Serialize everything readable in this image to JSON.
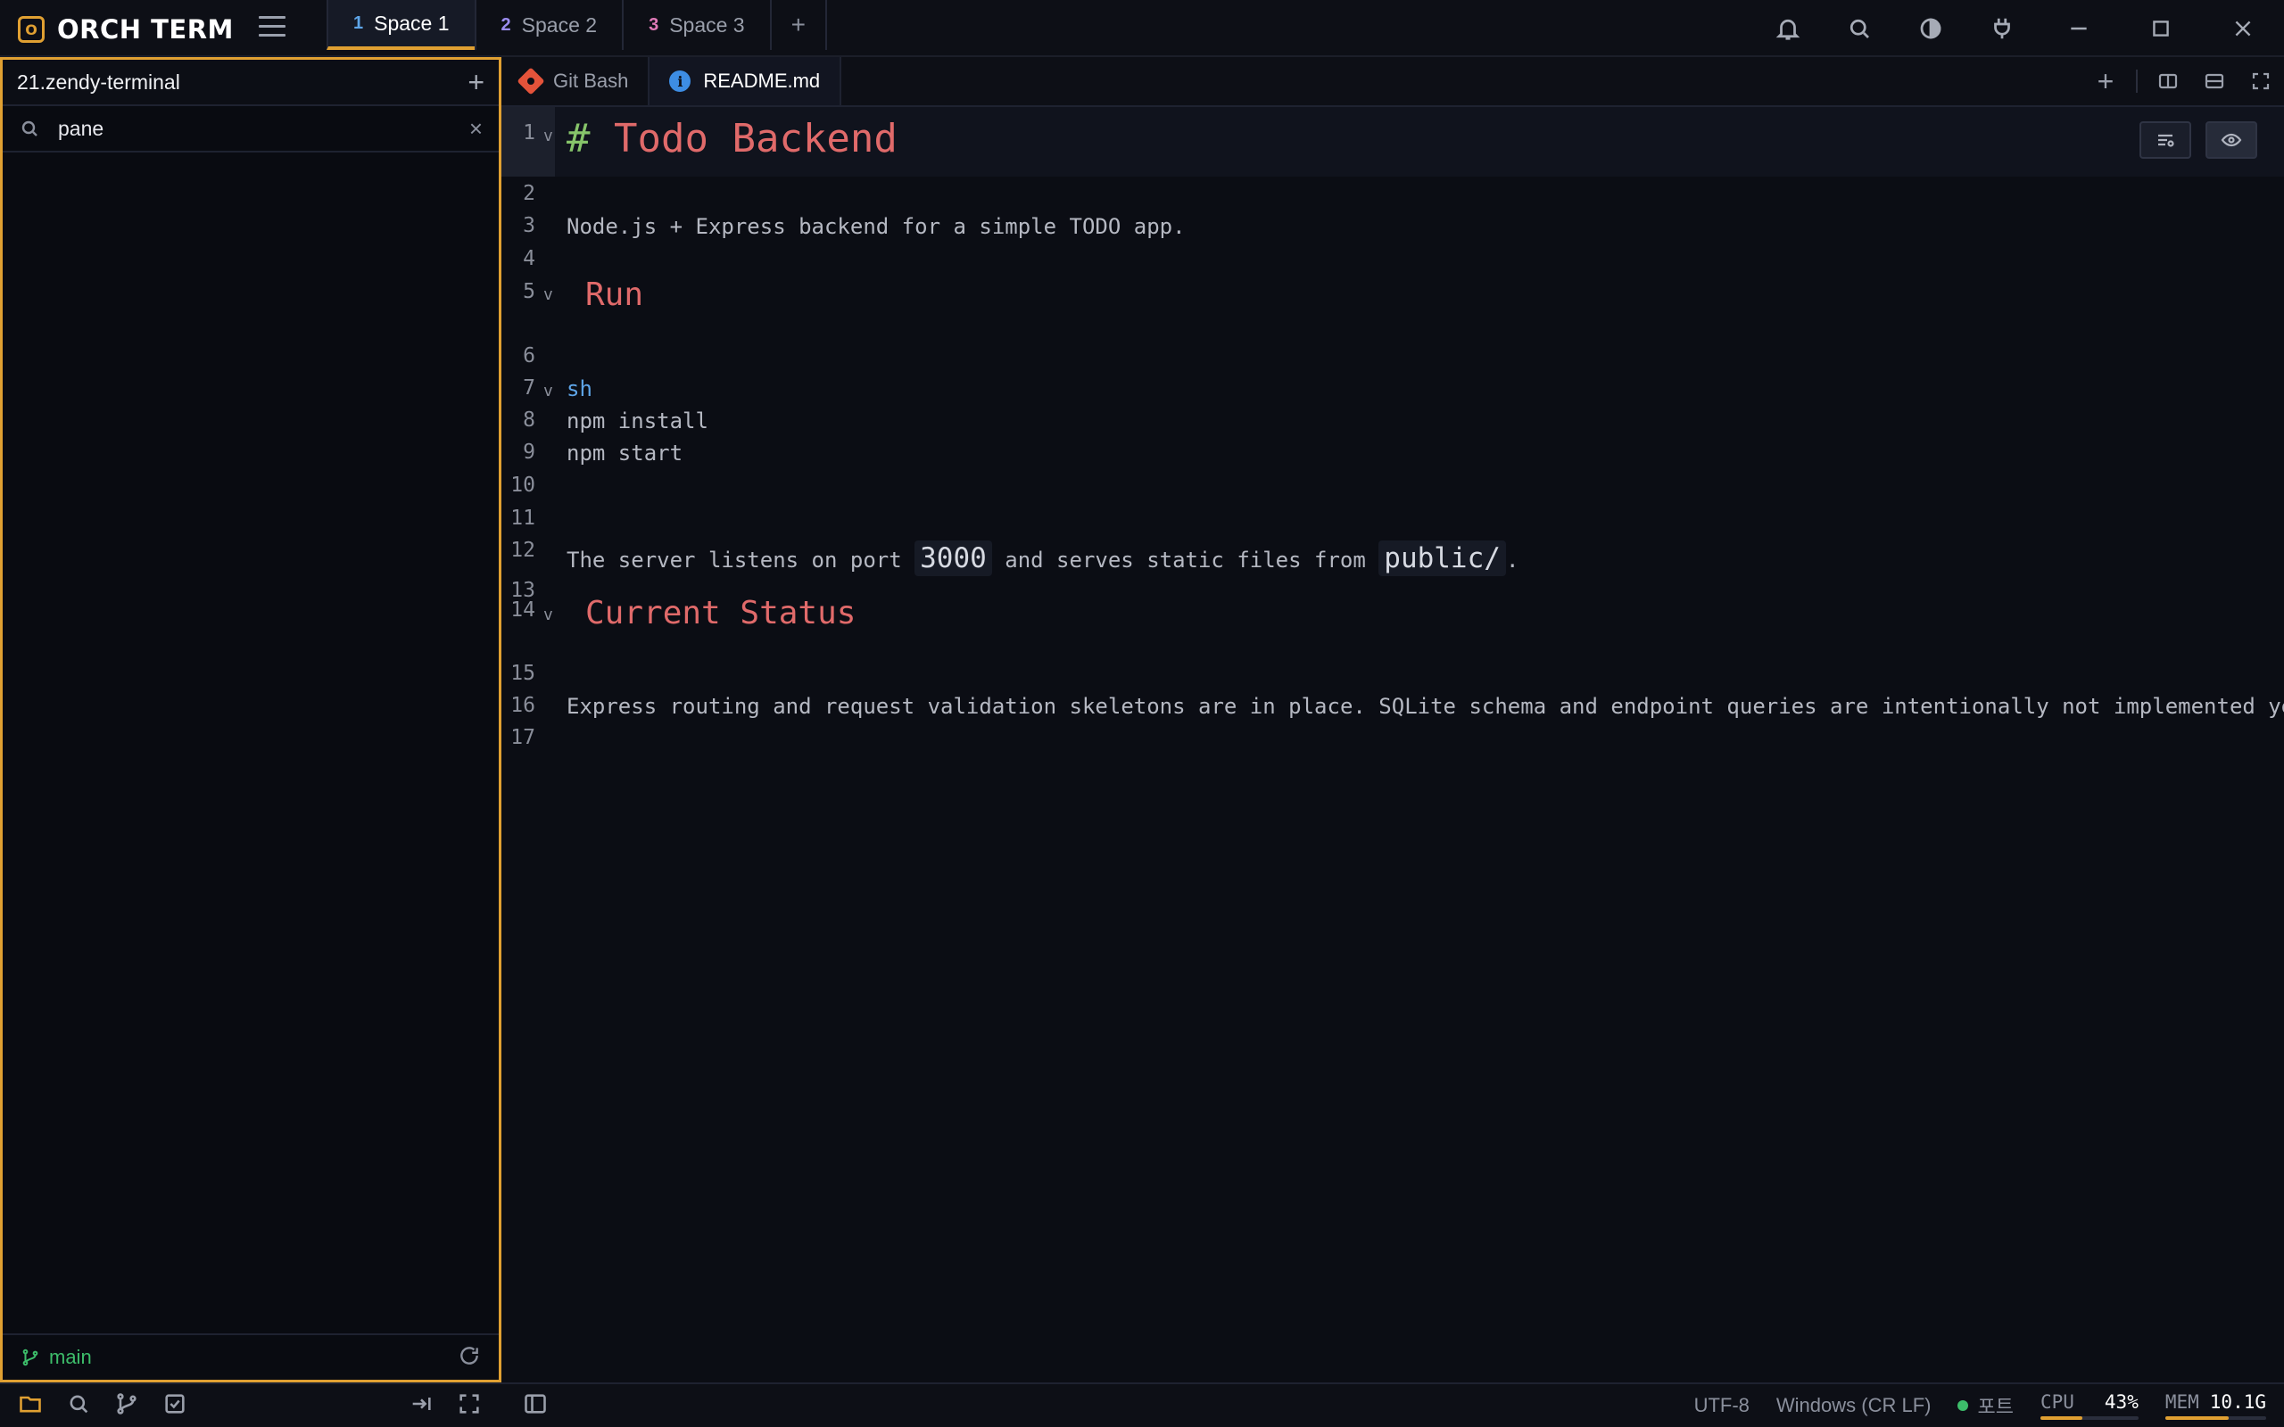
{
  "app": {
    "name": "ORCH TERM",
    "logo_letter": "O"
  },
  "spaces": [
    {
      "num": "1",
      "label": "Space 1",
      "color": "#5ea5e8",
      "active": true
    },
    {
      "num": "2",
      "label": "Space 2",
      "color": "#9b8cf0",
      "active": false
    },
    {
      "num": "3",
      "label": "Space 3",
      "color": "#e07ab8",
      "active": false
    }
  ],
  "space_add_label": "+",
  "sidebar": {
    "title": "21.zendy-terminal",
    "add_label": "+",
    "search_value": "pane",
    "clear_label": "×",
    "branch": "main"
  },
  "editor_tabs": [
    {
      "label": "Git Bash",
      "icon": "git-icon",
      "active": false
    },
    {
      "label": "README.md",
      "icon": "info-icon",
      "active": true
    }
  ],
  "editor_add_label": "+",
  "lines": [
    {
      "n": "1",
      "fold": "v"
    },
    {
      "n": "2"
    },
    {
      "n": "3",
      "text": "Node.js + Express backend for a simple TODO app."
    },
    {
      "n": "4"
    },
    {
      "n": "5",
      "fold": "v"
    },
    {
      "n": "6"
    },
    {
      "n": "7",
      "fold": "v"
    },
    {
      "n": "8",
      "text": "npm install"
    },
    {
      "n": "9",
      "text": "npm start"
    },
    {
      "n": "10"
    },
    {
      "n": "11"
    },
    {
      "n": "12"
    },
    {
      "n": "13"
    },
    {
      "n": "14",
      "fold": "v"
    },
    {
      "n": "15"
    },
    {
      "n": "16",
      "text": "Express routing and request validation skeletons are in place. SQLite schema and endpoint queries are intentionally not implemented yet be"
    },
    {
      "n": "17"
    }
  ],
  "doc": {
    "h1_hash": "#",
    "h1_text": "Todo Backend",
    "h2_run": "Run",
    "lang": "sh",
    "line12_a": "The server listens on port ",
    "line12_code1": "3000",
    "line12_b": " and serves static files from ",
    "line12_code2": "public/",
    "line12_c": ".",
    "h2_status": "Current Status"
  },
  "status": {
    "encoding": "UTF-8",
    "line_ending": "Windows (CR LF)",
    "port_label": "포트",
    "cpu_label": "CPU",
    "cpu_value": "43%",
    "cpu_fraction": 0.43,
    "mem_label": "MEM",
    "mem_value": "10.1G",
    "mem_fraction": 0.63
  },
  "colors": {
    "accent": "#e0a032",
    "heading": "#e06a6a",
    "hash": "#86c46a",
    "lang": "#5ea5e8",
    "git_branch": "#3dbd6a"
  }
}
